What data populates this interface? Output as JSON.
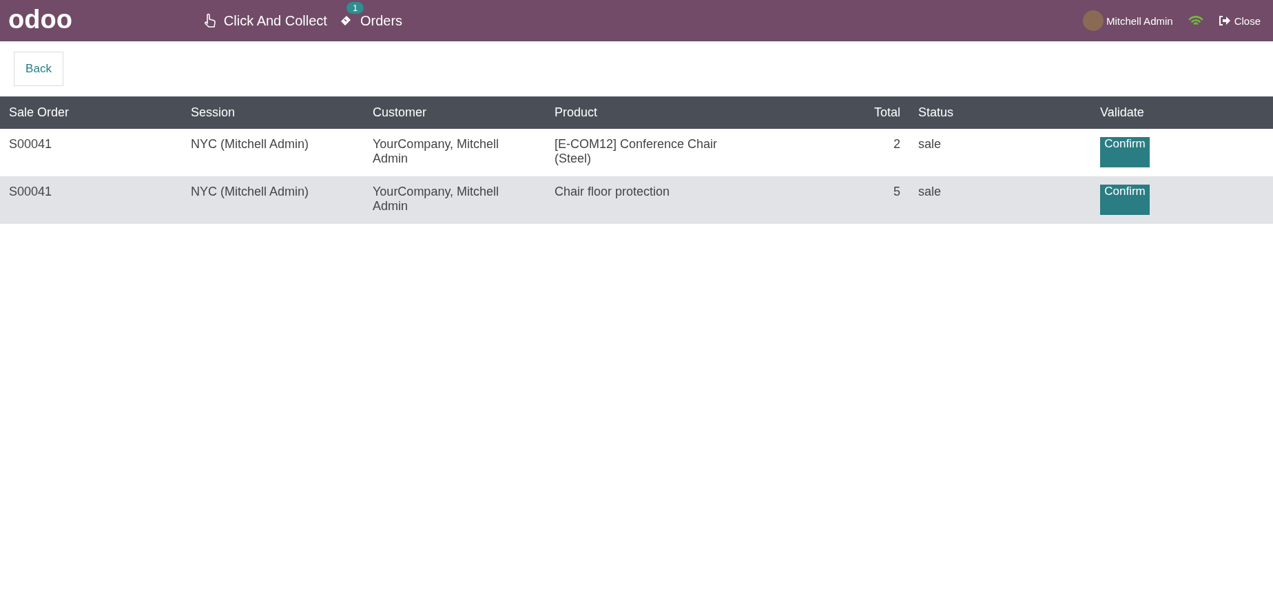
{
  "navbar": {
    "logo": "odoo",
    "items": [
      {
        "label": "Click And Collect",
        "kind": "hand"
      },
      {
        "label": "Orders",
        "kind": "ticket",
        "badge": "1"
      }
    ],
    "user": "Mitchell Admin",
    "close": "Close"
  },
  "back_button": "Back",
  "table": {
    "columns": [
      "Sale Order",
      "Session",
      "Customer",
      "Product",
      "Total",
      "Status",
      "Validate"
    ],
    "rows": [
      {
        "sale_order": "S00041",
        "session": "NYC (Mitchell Admin)",
        "customer": "YourCompany, Mitchell Admin",
        "product": "[E-COM12] Conference Chair (Steel)",
        "total": "2",
        "status": "sale",
        "action": "Confirm"
      },
      {
        "sale_order": "S00041",
        "session": "NYC (Mitchell Admin)",
        "customer": "YourCompany, Mitchell Admin",
        "product": "Chair floor protection",
        "total": "5",
        "status": "sale",
        "action": "Confirm"
      }
    ]
  }
}
